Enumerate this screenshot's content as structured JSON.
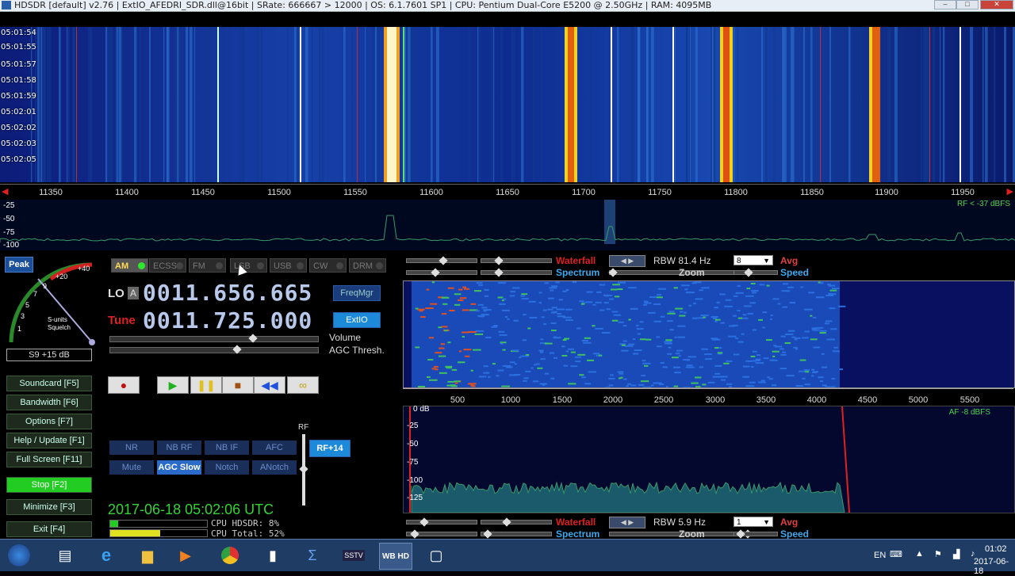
{
  "window": {
    "title": "HDSDR  [default]  v2.76   |   ExtIO_AFEDRI_SDR.dll@16bit   |   SRate: 666667 > 12000   |   OS: 6.1.7601 SP1   |   CPU: Pentium Dual-Core        E5200  @ 2.50GHz   |   RAM: 4095MB"
  },
  "waterfall": {
    "timestamps": [
      "05:01:54",
      "05:01:55",
      "05:01:57",
      "05:01:58",
      "05:01:59",
      "05:02:01",
      "05:02:02",
      "05:02:03",
      "05:02:05"
    ],
    "freq_ticks": [
      "11350",
      "11400",
      "11450",
      "11500",
      "11550",
      "11600",
      "11650",
      "11700",
      "11750",
      "11800",
      "11850",
      "11900",
      "11950"
    ],
    "db_labels": [
      "-25",
      "-50",
      "-75",
      "-100"
    ],
    "rf_level": "RF < -37 dBFS"
  },
  "panel": {
    "peak": "Peak",
    "smeter_labels": {
      "plus20": "+20",
      "plus40": "+40",
      "nine": "9",
      "seven": "7",
      "five": "5",
      "three": "3",
      "one": "1",
      "squelch1": "S-units",
      "squelch2": "Squelch"
    },
    "s_reading": "S9 +15 dB",
    "modes": [
      "AM",
      "ECSS",
      "FM",
      "LSB",
      "USB",
      "CW",
      "DRM"
    ],
    "lo_label": "LO",
    "lo_letter": "A",
    "lo_freq": "0011.656.665",
    "tune_label": "Tune",
    "tune_freq": "0011.725.000",
    "freqmgr": "FreqMgr",
    "extio": "ExtIO",
    "volume": "Volume",
    "agc_thresh": "AGC Thresh.",
    "side_buttons": [
      "Soundcard [F5]",
      "Bandwidth [F6]",
      "Options [F7]",
      "Help / Update [F1]",
      "Full Screen [F11]",
      "Stop [F2]",
      "Minimize [F3]",
      "Exit [F4]"
    ],
    "rf_label": "RF",
    "rf_gain": "RF+14",
    "fn_row1": [
      "NR",
      "NB RF",
      "NB IF",
      "AFC"
    ],
    "fn_row2": [
      "Mute",
      "AGC Slow",
      "Notch",
      "ANotch"
    ],
    "datetime": "2017-06-18   05:02:06 UTC",
    "cpu_hdsdr": "CPU HDSDR:  8%",
    "cpu_total": "CPU Total: 52%"
  },
  "rf_controls": {
    "waterfall": "Waterfall",
    "spectrum": "Spectrum",
    "rbw": "RBW 81.4 Hz",
    "zoom": "Zoom",
    "avg_value": "8",
    "avg": "Avg",
    "speed": "Speed"
  },
  "af": {
    "axis_ticks": [
      "500",
      "1000",
      "1500",
      "2000",
      "2500",
      "3000",
      "3500",
      "4000",
      "4500",
      "5000",
      "5500"
    ],
    "db_labels": [
      "0 dB",
      "-25",
      "-50",
      "-75",
      "-100",
      "-125"
    ],
    "af_level": "AF -8 dBFS"
  },
  "af_controls": {
    "waterfall": "Waterfall",
    "spectrum": "Spectrum",
    "rbw": "RBW  5.9 Hz",
    "zoom": "Zoom",
    "avg_value": "1",
    "avg": "Avg",
    "speed": "Speed"
  },
  "taskbar": {
    "lang": "EN",
    "time": "01:02",
    "date": "2017-06-18"
  },
  "colors": {
    "stop_green": "#22cc22",
    "waterfall_blue": "#0a1a6a",
    "freq_digits": "#b8c8ea"
  }
}
